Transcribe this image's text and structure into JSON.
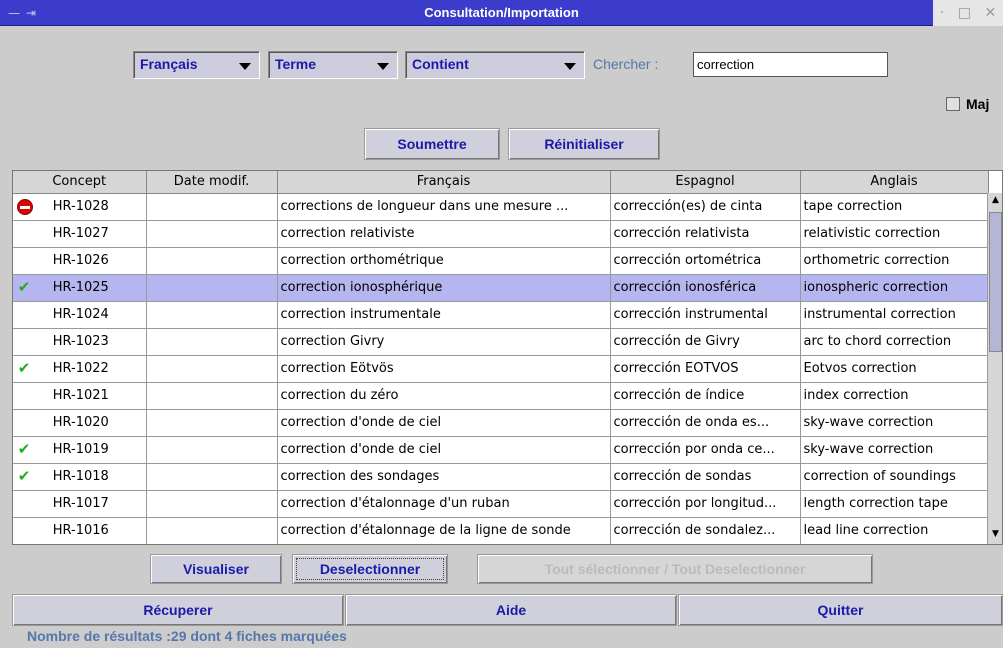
{
  "window": {
    "title": "Consultation/Importation",
    "left_controls": "— ⇥",
    "right_controls": [
      "·",
      "□",
      "✕"
    ]
  },
  "search": {
    "language": "Français",
    "field": "Terme",
    "operator": "Contient",
    "chercher_label": "Chercher :",
    "query": "correction",
    "maj_label": "Maj",
    "maj_checked": false
  },
  "actions": {
    "submit": "Soumettre",
    "reset": "Réinitialiser"
  },
  "table": {
    "headers": [
      "Concept",
      "Date modif.",
      "Français",
      "Espagnol",
      "Anglais"
    ],
    "rows": [
      {
        "marker": "stop",
        "concept": "HR-1028",
        "date": "",
        "fr": "corrections de longueur dans une mesure ...",
        "es": "corrección(es) de cinta",
        "en": "tape correction"
      },
      {
        "marker": "",
        "concept": "HR-1027",
        "date": "",
        "fr": "correction relativiste",
        "es": "corrección relativista",
        "en": "relativistic correction"
      },
      {
        "marker": "",
        "concept": "HR-1026",
        "date": "",
        "fr": "correction orthométrique",
        "es": "corrección ortométrica",
        "en": "orthometric correction"
      },
      {
        "marker": "check",
        "concept": "HR-1025",
        "date": "",
        "fr": "correction ionosphérique",
        "es": "corrección ionosférica",
        "en": "ionospheric correction",
        "selected": true
      },
      {
        "marker": "",
        "concept": "HR-1024",
        "date": "",
        "fr": "correction instrumentale",
        "es": "corrección instrumental",
        "en": "instrumental correction"
      },
      {
        "marker": "",
        "concept": "HR-1023",
        "date": "",
        "fr": "correction Givry",
        "es": "corrección de Givry",
        "en": "arc to chord correction"
      },
      {
        "marker": "check",
        "concept": "HR-1022",
        "date": "",
        "fr": "correction Eötvös",
        "es": "corrección EOTVOS",
        "en": "Eotvos correction"
      },
      {
        "marker": "",
        "concept": "HR-1021",
        "date": "",
        "fr": "correction du zéro",
        "es": "corrección de índice",
        "en": "index correction"
      },
      {
        "marker": "",
        "concept": "HR-1020",
        "date": "",
        "fr": "correction d'onde de ciel",
        "es": "corrección de onda es...",
        "en": "sky-wave correction"
      },
      {
        "marker": "check",
        "concept": "HR-1019",
        "date": "",
        "fr": "correction d'onde de ciel",
        "es": "corrección por onda ce...",
        "en": "sky-wave correction"
      },
      {
        "marker": "check",
        "concept": "HR-1018",
        "date": "",
        "fr": "correction des sondages",
        "es": "corrección de sondas",
        "en": "correction of soundings"
      },
      {
        "marker": "",
        "concept": "HR-1017",
        "date": "",
        "fr": "correction d'étalonnage d'un ruban",
        "es": "corrección por longitud...",
        "en": "length correction tape"
      },
      {
        "marker": "",
        "concept": "HR-1016",
        "date": "",
        "fr": "correction d'étalonnage de la ligne de sonde",
        "es": "corrección de sondalez...",
        "en": "lead line correction"
      }
    ]
  },
  "row_buttons": {
    "view": "Visualiser",
    "deselect": "Deselectionner",
    "select_all": "Tout sélectionner / Tout Deselectionner"
  },
  "footer_buttons": {
    "retrieve": "Récuperer",
    "help": "Aide",
    "quit": "Quitter"
  },
  "status": "Nombre de résultats :29 dont 4 fiches marquées",
  "colors": {
    "accent": "#1a1aaa",
    "selection": "#b5b5f0",
    "titlebar": "#3b3bcc"
  }
}
